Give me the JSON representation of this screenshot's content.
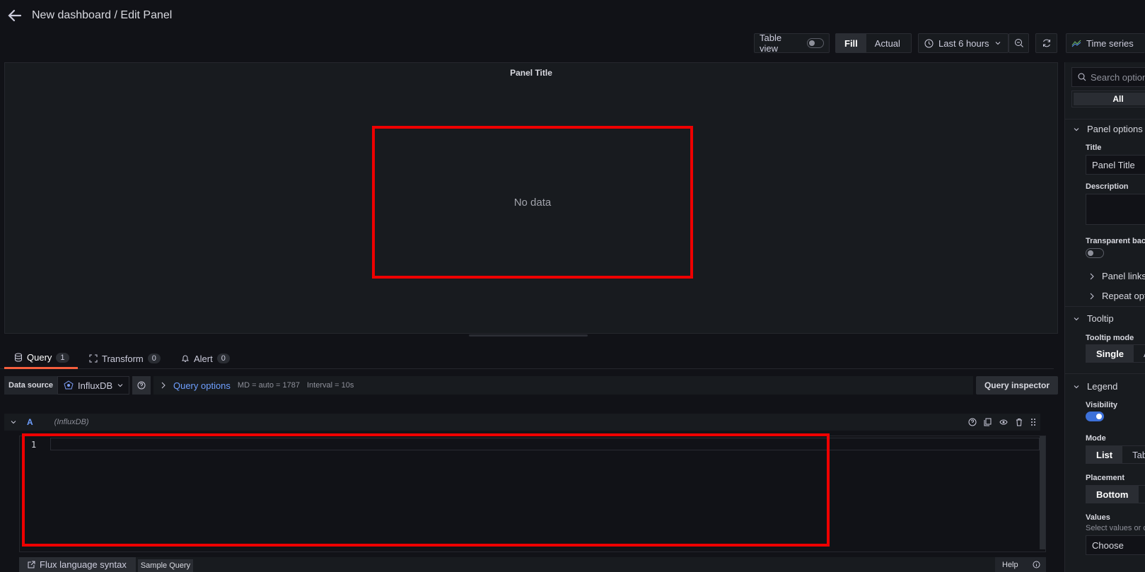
{
  "header": {
    "title": "New dashboard / Edit Panel"
  },
  "toolbar": {
    "table_view_label": "Table view",
    "fill_label": "Fill",
    "actual_label": "Actual",
    "time_range": "Last 6 hours",
    "visualization": "Time series"
  },
  "panel": {
    "title": "Panel Title",
    "no_data": "No data"
  },
  "tabs": [
    {
      "label": "Query",
      "count": "1"
    },
    {
      "label": "Transform",
      "count": "0"
    },
    {
      "label": "Alert",
      "count": "0"
    }
  ],
  "query_row": {
    "data_source_label": "Data source",
    "data_source": "InfluxDB",
    "query_options": "Query options",
    "md": "MD = auto = 1787",
    "interval": "Interval = 10s",
    "inspector": "Query inspector"
  },
  "query": {
    "ref_id": "A",
    "datasource": "(InfluxDB)",
    "line_number": "1"
  },
  "bottom": {
    "flux_syntax": "Flux language syntax",
    "sample_query": "Sample Query",
    "help": "Help"
  },
  "options": {
    "search_placeholder": "Search options",
    "filter_all": "All",
    "panel_options": {
      "heading": "Panel options",
      "title_label": "Title",
      "title_value": "Panel Title",
      "description_label": "Description",
      "transparent_label": "Transparent back",
      "links_label": "Panel links",
      "repeat_label": "Repeat opt"
    },
    "tooltip": {
      "heading": "Tooltip",
      "mode_label": "Tooltip mode",
      "single": "Single",
      "all_partial": "A"
    },
    "legend": {
      "heading": "Legend",
      "visibility_label": "Visibility",
      "mode_label": "Mode",
      "list": "List",
      "table_partial": "Tab",
      "placement_label": "Placement",
      "bottom": "Bottom",
      "values_label": "Values",
      "values_help": "Select values or c",
      "choose": "Choose"
    }
  }
}
